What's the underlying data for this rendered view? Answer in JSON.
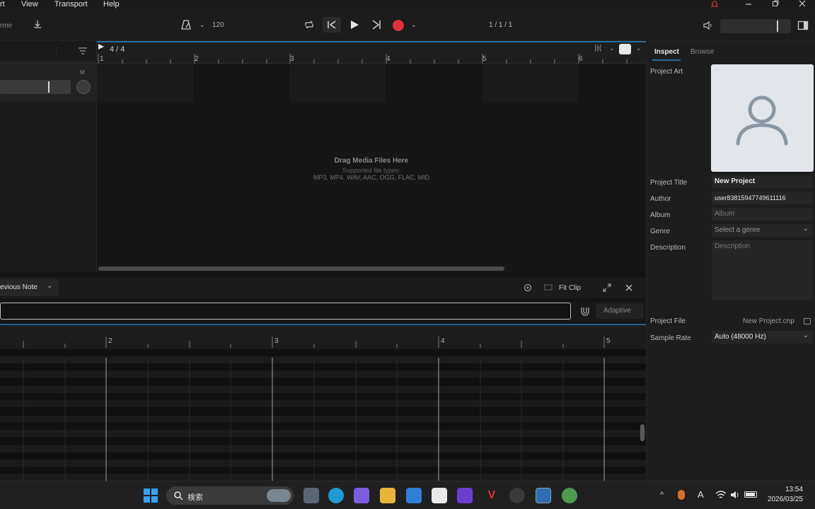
{
  "menu": {
    "items": [
      "rt",
      "View",
      "Transport",
      "Help"
    ]
  },
  "toolbar": {
    "left_label": "rme",
    "tempo": "120",
    "position": "1 / 1 / 1",
    "accent_color": "#e0323c"
  },
  "arrange": {
    "time_signature": "4 / 4",
    "bar_numbers": [
      "1",
      "2",
      "3",
      "4",
      "5",
      "6"
    ],
    "track_mute": "M",
    "drop_title": "Drag Media Files Here",
    "drop_sub": "Supported file types:",
    "drop_types": "MP3, MP4, WAV, AAC, OGG, FLAC, MID"
  },
  "inspector": {
    "tabs": [
      "Inspect",
      "Browse"
    ],
    "project_art_label": "Project Art",
    "fields": {
      "title_label": "Project Title",
      "title_value": "New Project",
      "author_label": "Author",
      "author_value": "user83815947749611116",
      "album_label": "Album",
      "album_placeholder": "Album",
      "genre_label": "Genre",
      "genre_placeholder": "Select a genre",
      "description_label": "Description",
      "description_placeholder": "Description"
    },
    "project_file_label": "Project File",
    "project_file_value": "New Project.cnp",
    "sample_rate_label": "Sample Rate",
    "sample_rate_value": "Auto (48000 Hz)"
  },
  "piano_roll": {
    "scale_select": "evious Note",
    "fit_clip": "Fit Clip",
    "mode_button": "Adaptive",
    "bar_numbers": [
      "2",
      "3",
      "4",
      "5"
    ]
  },
  "taskbar": {
    "search_label": "検索",
    "time": "13:54",
    "date": "2026/03/25",
    "ime": "A"
  }
}
